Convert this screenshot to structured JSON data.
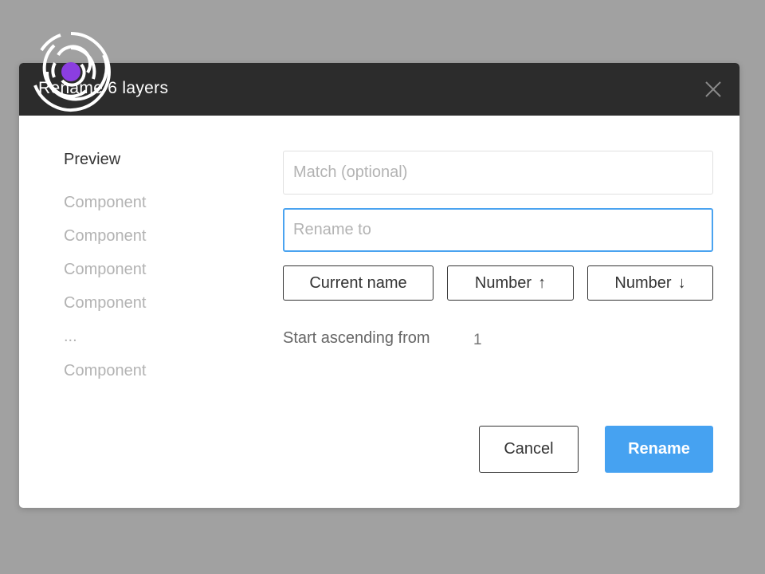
{
  "dialog": {
    "title": "Rename 6 layers",
    "close_icon": "close-x-icon"
  },
  "logo": {
    "icon": "concentric-rings-logo-icon",
    "dot_color": "#8b3ee0"
  },
  "preview": {
    "title": "Preview",
    "items": [
      "Component",
      "Component",
      "Component",
      "Component",
      "...",
      "Component"
    ]
  },
  "form": {
    "match_placeholder": "Match (optional)",
    "match_value": "",
    "rename_placeholder": "Rename to",
    "rename_value": "",
    "tokens": [
      {
        "label": "Current name",
        "arrow": ""
      },
      {
        "label": "Number",
        "arrow": "↑"
      },
      {
        "label": "Number",
        "arrow": "↓"
      }
    ],
    "start_label": "Start ascending from",
    "start_value": "1"
  },
  "actions": {
    "cancel_label": "Cancel",
    "rename_label": "Rename"
  },
  "colors": {
    "backdrop": "#a1a1a1",
    "titlebar": "#2c2c2c",
    "accent": "#46a2f1",
    "focus_border": "#4aa3f0"
  }
}
